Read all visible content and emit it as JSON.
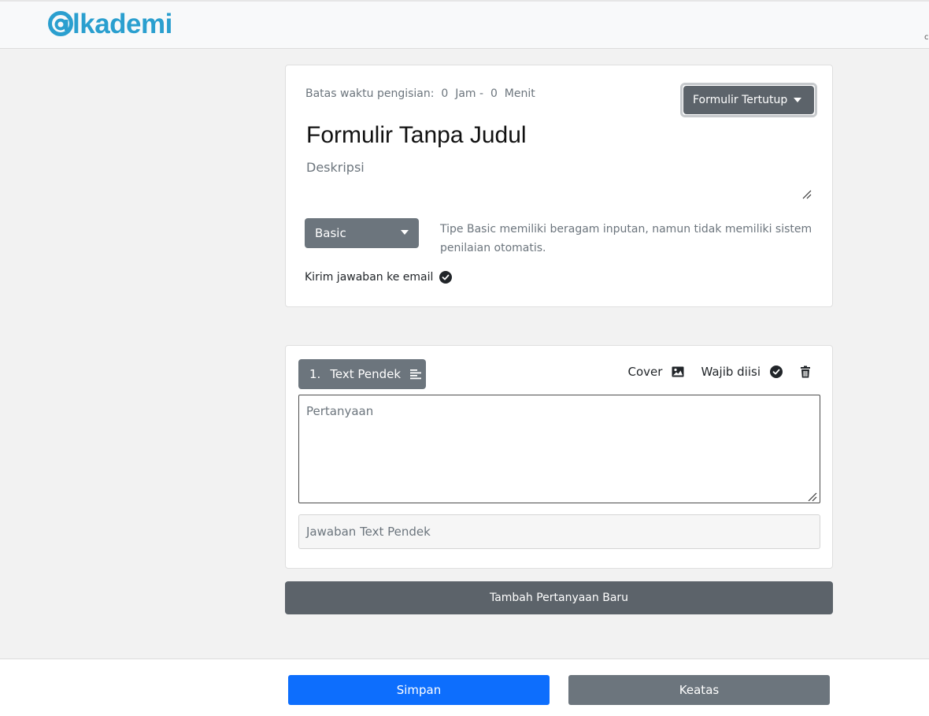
{
  "brand": {
    "logo_text": "lkademi",
    "logo_mark": "at-sign-logo-mark",
    "color": "#2a9fcf"
  },
  "form": {
    "time_limit_label": "Batas waktu pengisian:",
    "time_hours": "0",
    "time_hours_unit": "Jam -",
    "time_minutes": "0",
    "time_minutes_unit": "Menit",
    "status_label": "Formulir Tertutup",
    "title": "Formulir Tanpa Judul",
    "description_placeholder": "Deskripsi",
    "type_label": "Basic",
    "type_hint": "Tipe Basic memiliki beragam inputan, namun tidak memiliki sistem penilaian otomatis.",
    "email_label": "Kirim jawaban ke email"
  },
  "question": {
    "number": "1.",
    "type_label": "Text Pendek",
    "cover_label": "Cover",
    "required_label": "Wajib diisi",
    "question_placeholder": "Pertanyaan",
    "answer_placeholder": "Jawaban Text Pendek"
  },
  "actions": {
    "add_question": "Tambah Pertanyaan Baru",
    "save": "Simpan",
    "to_top": "Keatas"
  },
  "colors": {
    "primary": "#0d6efd",
    "secondary": "#6c757d",
    "dark_secondary": "#5c636a"
  },
  "icons": {
    "status_caret": "chevron-down-icon",
    "type_caret": "chevron-down-icon",
    "email_check": "check-circle-icon",
    "question_type": "text-lines-icon",
    "cover": "image-icon",
    "required": "check-circle-icon",
    "delete": "trash-icon"
  }
}
